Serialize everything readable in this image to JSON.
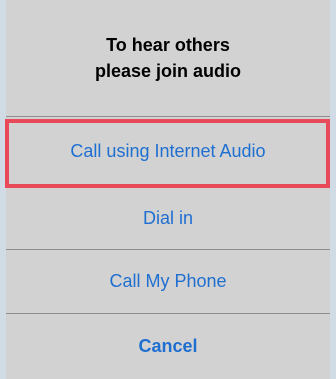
{
  "dialog": {
    "title_line1": "To hear others",
    "title_line2": "please join audio",
    "options": [
      {
        "label": "Call using Internet Audio"
      },
      {
        "label": "Dial in"
      },
      {
        "label": "Call My Phone"
      }
    ],
    "cancel_label": "Cancel"
  },
  "colors": {
    "background": "#d0dbe6",
    "sheet": "#d2d2d2",
    "option_text": "#1f6fd1",
    "highlight_border": "#e84a5a"
  }
}
